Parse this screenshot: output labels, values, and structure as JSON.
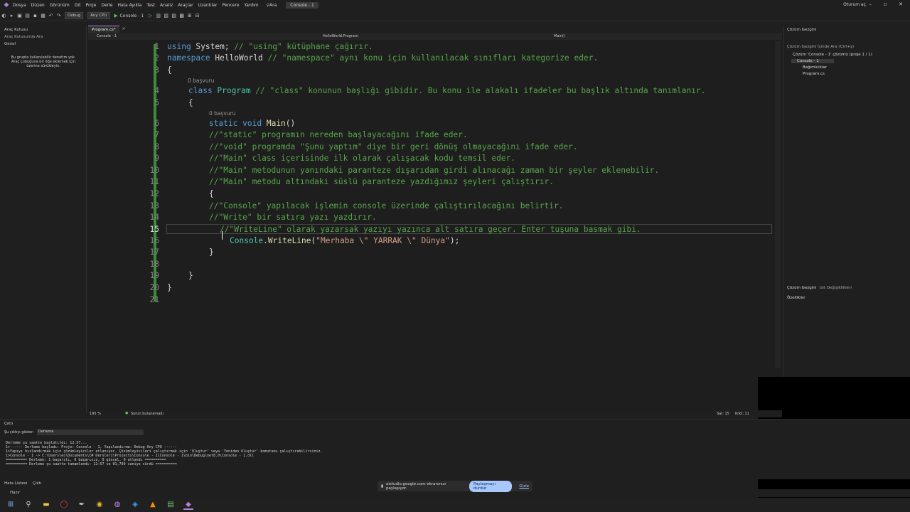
{
  "menu": {
    "items": [
      "Dosya",
      "Düzen",
      "Görünüm",
      "Git",
      "Proje",
      "Derle",
      "Hata Ayıkla",
      "Test",
      "Analiz",
      "Araçlar",
      "Uzantılar",
      "Pencere",
      "Yardım"
    ],
    "search": "Ara",
    "title": "Console - 1",
    "user": "Oturum aç"
  },
  "toolbar": {
    "config": "Debug",
    "platform": "Any CPU",
    "run": "Console - 1"
  },
  "left_panel": {
    "title": "Araç Kutusu",
    "search": "Araç Kutusunda Ara",
    "group": "Genel",
    "empty": "Bu grupta kullanılabilir denetim yok. Araç çubuğuna bir öğe eklemek için üzerine sürükleyin."
  },
  "editor": {
    "tab": "Program.cs*",
    "project": "Console - 1",
    "nav_class": "HelloWorld.Program",
    "nav_member": "Main()",
    "line_numbers": [
      "1",
      "2",
      "3",
      "4",
      "5",
      "6",
      "7",
      "8",
      "9",
      "10",
      "11",
      "12",
      "13",
      "14",
      "15",
      "16",
      "17",
      "18",
      "19",
      "20",
      "21"
    ],
    "ref_class": "0 başvuru",
    "ref_method": "0 başvuru",
    "l1a": "using",
    "l1b": " System;",
    "l1c": " // \"using\" kütüphane çağırır.",
    "l2a": "namespace",
    "l2b": " HelloWorld",
    "l2c": " // \"namespace\" aynı konu için kullanılacak sınıfları kategorize eder.",
    "l3": "{",
    "l4a": "class",
    "l4b": " Program",
    "l4c": " // \"class\" konunun başlığı gibidir. Bu konu ile alakalı ifadeler bu başlık altında tanımlanır.",
    "l5": "{",
    "l6a": "static",
    "l6b": " void",
    "l6c": " Main",
    "l6d": "()",
    "l7": "//\"static\" programın nereden başlayacağını ifade eder.",
    "l8": "//\"void\" programda \"Şunu yaptım\" diye bir geri dönüş olmayacağını ifade eder.",
    "l9": "//\"Main\" class içerisinde ilk olarak çalışacak kodu temsil eder.",
    "l10": "//\"Main\" metodunun yanındaki paranteze dışarıdan girdi alınacağı zaman bir şeyler eklenebilir.",
    "l11": "//\"Main\" metodu altındaki süslü paranteze yazdığımız şeyleri çalıştırır.",
    "l12": "{",
    "l13": "//\"Console\" yapılacak işlemin console üzerinde çalıştırılacağını belirtir.",
    "l14": "//\"Write\" bir satıra yazı yazdırır.",
    "l15": "//\"WriteLine\" olarak yazarsak yazıyı yazınca alt satıra geçer. Enter tuşuna basmak gibi.",
    "l16a": "Console",
    "l16b": ".",
    "l16c": "WriteLine",
    "l16d": "(",
    "l16e": "\"Merhaba \\\" YARRAK \\\" Dünya\"",
    "l16f": ");",
    "l17": "}",
    "l19": "}",
    "l20": "}"
  },
  "right_panel": {
    "title": "Çözüm Gezgini",
    "search": "Çözüm Gezgini İçinde Ara (Ctrl+ş)",
    "solution": "Çözüm 'Console - 1' çözümü (proje 1 / 1)",
    "project": "Console - 1",
    "deps": "Bağımlılıklar",
    "file": "Program.cs",
    "tab1": "Çözüm Gezgini",
    "tab2": "Git Değişiklikleri",
    "props": "Özellikler"
  },
  "status": {
    "zoom": "195 %",
    "issues": "Sorun bulunamadı",
    "pos": "Sat: 15",
    "col": "Krkt: 11"
  },
  "output": {
    "title": "Çıktı",
    "show_label": "Şu çıktıyı göster:",
    "source": "Derleme",
    "lines": [
      "Derleme şu saatte başlatıldı: 12:57...",
      "1>------ Derleme başladı: Proje: Console - 1, Yapılandırma: Debug Any CPU ------",
      "1>Yapıyı hızlandırmak için çözümleyiciler atlanıyor. Çözümleyicileri çalıştırmak için 'Oluştur' veya 'Yeniden Oluştur' komutunu çalıştırabilirsiniz.",
      "1>Console - 1 -> C:\\Users\\ec\\Documents\\C# Dersleri\\Projects\\Console - 1\\Console - 1\\bin\\Debug\\net8.0\\Console - 1.dll",
      "========== Derleme: 1 başarılı, 0 başarısız, 0 güncel, 0 atlandı ==========",
      "========== Derleme şu saatte tamamlandı: 12:57 ve 01,799 saniye sürdü =========="
    ]
  },
  "bottom": {
    "tab1": "Hata Listesi",
    "tab2": "Çıktı",
    "ready": "Hazır"
  },
  "share": {
    "text": "aistudio.google.com ekranınızı paylaşıyor.",
    "stop": "Paylaşmayı durdur",
    "hide": "Gizle"
  }
}
